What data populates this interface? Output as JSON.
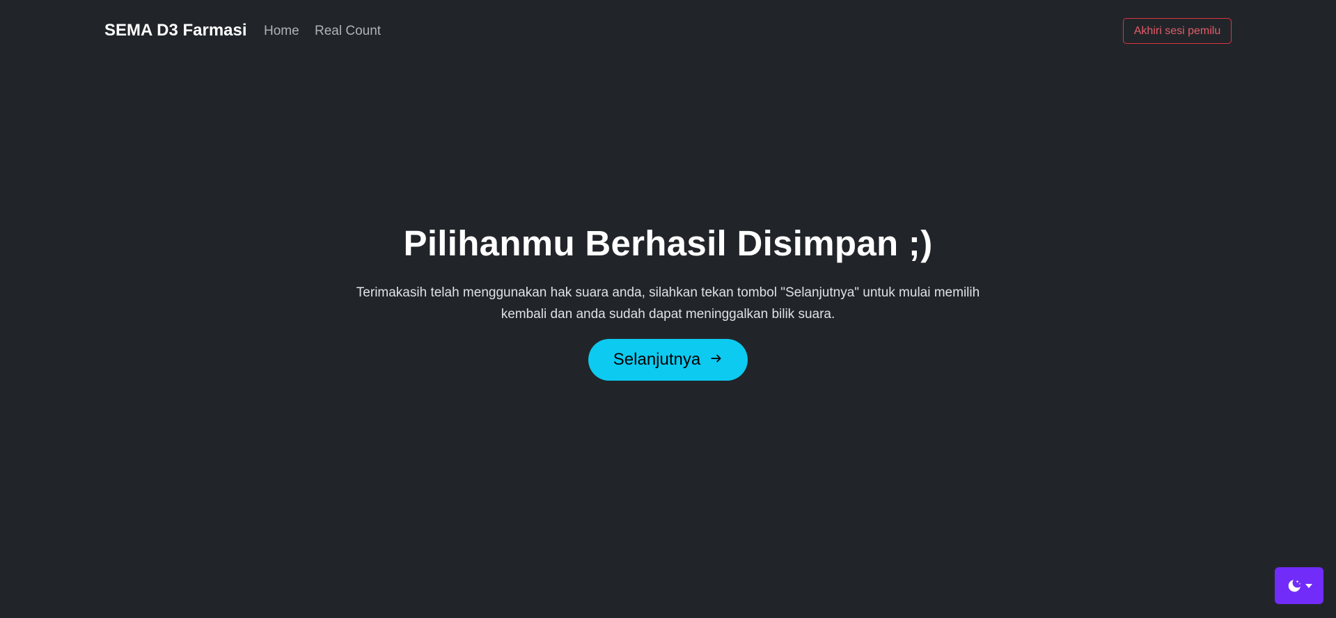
{
  "navbar": {
    "brand": "SEMA D3 Farmasi",
    "links": [
      {
        "label": "Home"
      },
      {
        "label": "Real Count"
      }
    ],
    "end_session_label": "Akhiri sesi pemilu"
  },
  "main": {
    "title": "Pilihanmu Berhasil Disimpan ;)",
    "message": "Terimakasih telah menggunakan hak suara anda, silahkan tekan tombol \"Selanjutnya\" untuk mulai memilih kembali dan anda sudah dapat meninggalkan bilik suara.",
    "next_button_label": "Selanjutnya",
    "next_button_icon": "arrow-right-icon"
  },
  "theme_toggle": {
    "icon": "moon-stars-icon",
    "caret_icon": "caret-down-icon"
  },
  "colors": {
    "background": "#212529",
    "accent_info": "#0dcaf0",
    "danger": "#dc3545",
    "theme_toggle_bg": "#712cf9"
  }
}
